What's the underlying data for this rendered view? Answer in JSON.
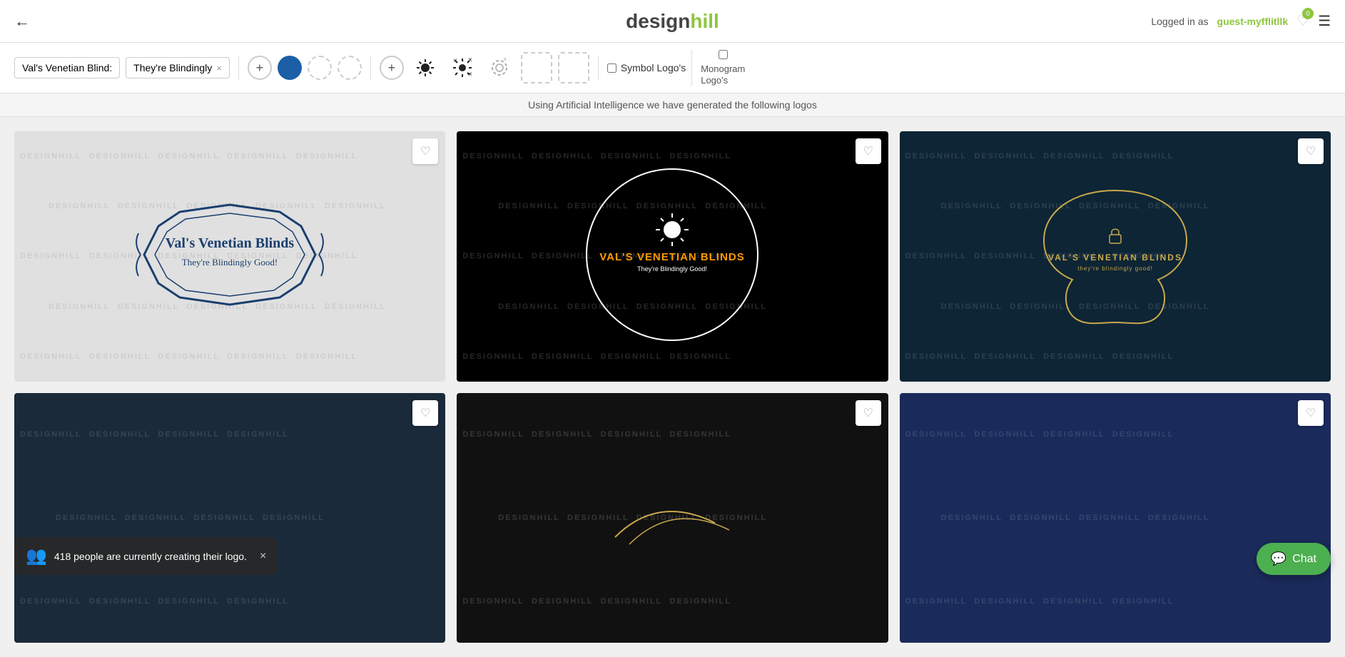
{
  "header": {
    "back_label": "←",
    "logo": "designhill",
    "logged_in_prefix": "Logged in as",
    "username": "guest-myfflitllk",
    "favorites_count": "0",
    "menu_icon": "☰"
  },
  "toolbar": {
    "tags": [
      {
        "id": "tag1",
        "label": "Val's Venetian Blind:",
        "removable": false
      },
      {
        "id": "tag2",
        "label": "They're Blindingly",
        "removable": true
      }
    ],
    "add_tag_label": "+",
    "colors": {
      "add_color_label": "+",
      "swatches": [
        {
          "id": "c1",
          "color": "#1c5fa6",
          "empty": false
        },
        {
          "id": "c2",
          "color": "",
          "empty": true
        },
        {
          "id": "c3",
          "color": "",
          "empty": true
        }
      ]
    },
    "symbols": [
      {
        "id": "s1",
        "icon": "☀",
        "style": "filled"
      },
      {
        "id": "s2",
        "icon": "✳",
        "style": "starburst"
      },
      {
        "id": "s3",
        "icon": "◎",
        "style": "ring"
      },
      {
        "id": "s4",
        "empty": true
      },
      {
        "id": "s5",
        "empty": true
      }
    ],
    "symbol_logo_label": "Symbol Logo's",
    "monogram_logo_label": "Monogram\nLogo's"
  },
  "sub_header": {
    "text": "Using Artificial Intelligence we have generated the following logos"
  },
  "logos": [
    {
      "id": "logo1",
      "bg": "light",
      "style": "frame",
      "main_text": "Val's Venetian Blinds",
      "sub_text": "They're Blindingly Good!",
      "favorited": false
    },
    {
      "id": "logo2",
      "bg": "black",
      "style": "circle",
      "main_text": "VAL'S VENETIAN BLINDS",
      "sub_text": "They're Blindingly Good!",
      "favorited": false
    },
    {
      "id": "logo3",
      "bg": "dark-navy",
      "style": "blob",
      "main_text": "VAL'S VENETIAN BLINDS",
      "sub_text": "they're blindingly good!",
      "favorited": false
    },
    {
      "id": "logo4",
      "bg": "dark-teal",
      "style": "partial",
      "main_text": "",
      "sub_text": "",
      "favorited": false
    },
    {
      "id": "logo5",
      "bg": "dark-black",
      "style": "partial",
      "main_text": "",
      "sub_text": "",
      "favorited": false
    },
    {
      "id": "logo6",
      "bg": "dark-blue",
      "style": "partial",
      "main_text": "",
      "sub_text": "",
      "favorited": false
    }
  ],
  "notification": {
    "text": "418 people are currently creating their logo.",
    "close_label": "×"
  },
  "chat": {
    "label": "Chat",
    "icon": "💬"
  },
  "watermark_text": "DESIGNHILL",
  "colors": {
    "green": "#8dc63f",
    "blue": "#1a3f6f",
    "gold": "#c9a84c",
    "orange": "#ff9900",
    "dark_navy": "#0d2535"
  }
}
